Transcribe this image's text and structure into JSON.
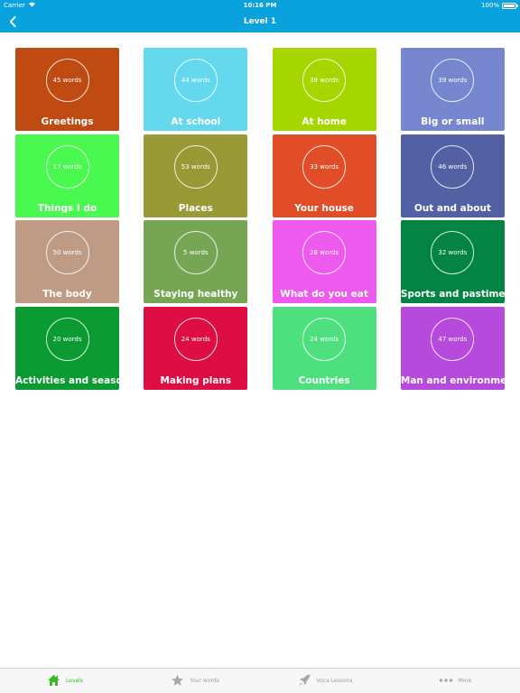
{
  "status": {
    "carrier": "Carrier",
    "time": "10:16 PM",
    "battery": "100%"
  },
  "navbar": {
    "title": "Level 1",
    "back_icon": "chevron-left-icon"
  },
  "colors": {
    "bar": "#0aa2dd",
    "tab_active": "#3cb72c",
    "tab_inactive": "#9a9a9a"
  },
  "tiles": [
    {
      "name": "Greetings",
      "count": "45 words",
      "color": "#c04b12"
    },
    {
      "name": "At school",
      "count": "44 words",
      "color": "#64d9ee"
    },
    {
      "name": "At home",
      "count": "38 words",
      "color": "#a5d600"
    },
    {
      "name": "Big or small",
      "count": "39 words",
      "color": "#7687cf"
    },
    {
      "name": "Things I do",
      "count": "17 words",
      "color": "#4af94f"
    },
    {
      "name": "Places",
      "count": "53 words",
      "color": "#999935"
    },
    {
      "name": "Your house",
      "count": "33 words",
      "color": "#e04d27"
    },
    {
      "name": "Out and about",
      "count": "46 words",
      "color": "#5460a4"
    },
    {
      "name": "The body",
      "count": "50 words",
      "color": "#bf9b86"
    },
    {
      "name": "Staying healthy",
      "count": "5 words",
      "color": "#76a654"
    },
    {
      "name": "What do you eat",
      "count": "26 words",
      "color": "#ee5aee"
    },
    {
      "name": "Sports and pastimes",
      "count": "32 words",
      "color": "#048444"
    },
    {
      "name": "Activities and seasons",
      "count": "20 words",
      "color": "#0c9a32"
    },
    {
      "name": "Making plans",
      "count": "24 words",
      "color": "#de0e44"
    },
    {
      "name": "Countries",
      "count": "24 words",
      "color": "#4ee07e"
    },
    {
      "name": "Man and environment",
      "count": "47 words",
      "color": "#b64adc"
    }
  ],
  "tabbar": {
    "levels": {
      "label": "Levels",
      "icon": "house-icon"
    },
    "your_words": {
      "label": "Your words",
      "icon": "star-icon"
    },
    "voca_lessons": {
      "label": "Voca Lessons",
      "icon": "rocket-icon"
    },
    "more": {
      "label": "More",
      "icon": "more-dots-icon"
    }
  }
}
